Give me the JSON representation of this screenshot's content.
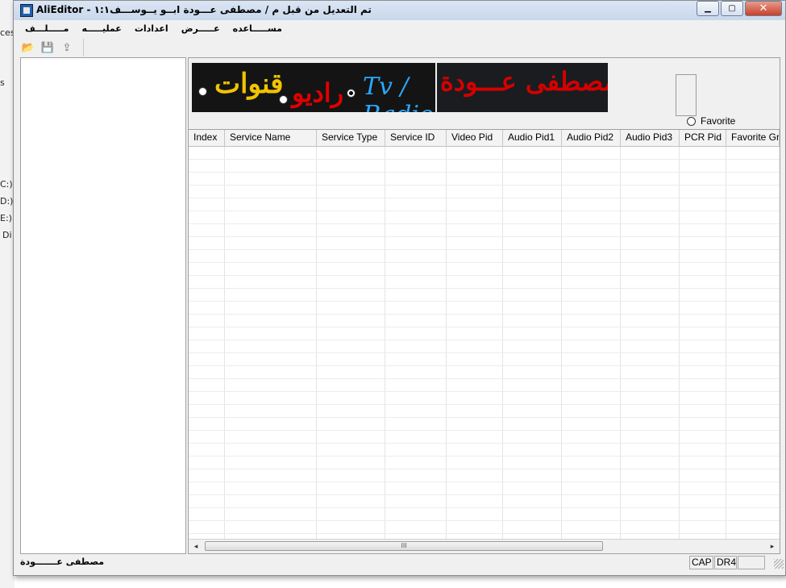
{
  "background": {
    "left_fragments": [
      "ces",
      "s",
      "C:)",
      "D:)",
      "E:)",
      "Di"
    ]
  },
  "window": {
    "title": "AliEditor - تم التعديل من قبل م / مصطفى عـــودة ابــو يــوســـف١:١",
    "controls": {
      "minimize": "▁",
      "maximize": "▢",
      "close": "✕"
    }
  },
  "menu": [
    "مـــــلـــف",
    "عمليـــــه",
    "اعدادات",
    "عـــــرض",
    "مســـــاعده"
  ],
  "toolbar": {
    "buttons": [
      {
        "name": "open",
        "icon": "folder-open-icon",
        "glyph": "📂"
      },
      {
        "name": "save",
        "icon": "save-icon",
        "glyph": "💾"
      },
      {
        "name": "export",
        "icon": "export-icon",
        "glyph": "⇪"
      }
    ]
  },
  "filter": {
    "channels_label": "قنوات",
    "radio_label": "راديو",
    "tv_radio_label": "Tv / Radio",
    "selected": "tv_radio",
    "banner_text": "م / مصطفى عـــودة",
    "favorite_label": "Favorite"
  },
  "table": {
    "columns": [
      "Index",
      "Service Name",
      "Service Type",
      "Service ID",
      "Video Pid",
      "Audio Pid1",
      "Audio Pid2",
      "Audio Pid3",
      "PCR Pid",
      "Favorite Gr"
    ],
    "rows": []
  },
  "scrollbar": {
    "left_arrow": "◂",
    "right_arrow": "▸",
    "grip": "III"
  },
  "status": {
    "text": "مصطفى عـــــــودة",
    "cap": "CAP",
    "drive": "DR4"
  },
  "colors": {
    "title_gradient": "#c8d7ec",
    "close_button": "#c7412c",
    "channels_text": "#f2c400",
    "radio_text": "#e00000",
    "tv_radio_text": "#2aa7ff",
    "banner_text": "#d40000"
  }
}
